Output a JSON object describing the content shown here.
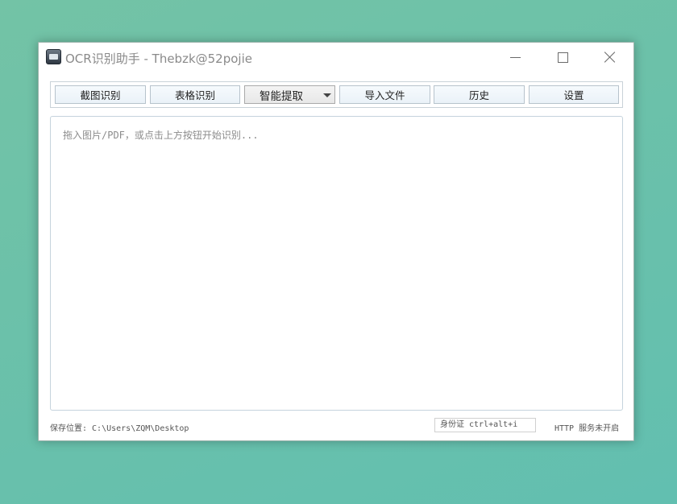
{
  "window": {
    "title": "OCR识别助手 - Thebzk@52pojie",
    "app_icon": "scanner-app-icon"
  },
  "toolbar": {
    "screenshot_ocr": "截图识别",
    "table_ocr": "表格识别",
    "smart_extract": "智能提取",
    "import_file": "导入文件",
    "history": "历史",
    "settings": "设置"
  },
  "editor": {
    "placeholder": "拖入图片/PDF，或点击上方按钮开始识别..."
  },
  "status": {
    "save_path": "保存位置: C:\\Users\\ZQM\\Desktop",
    "hotkey": "身份证 ctrl+alt+i",
    "http": "HTTP 服务未开启"
  }
}
